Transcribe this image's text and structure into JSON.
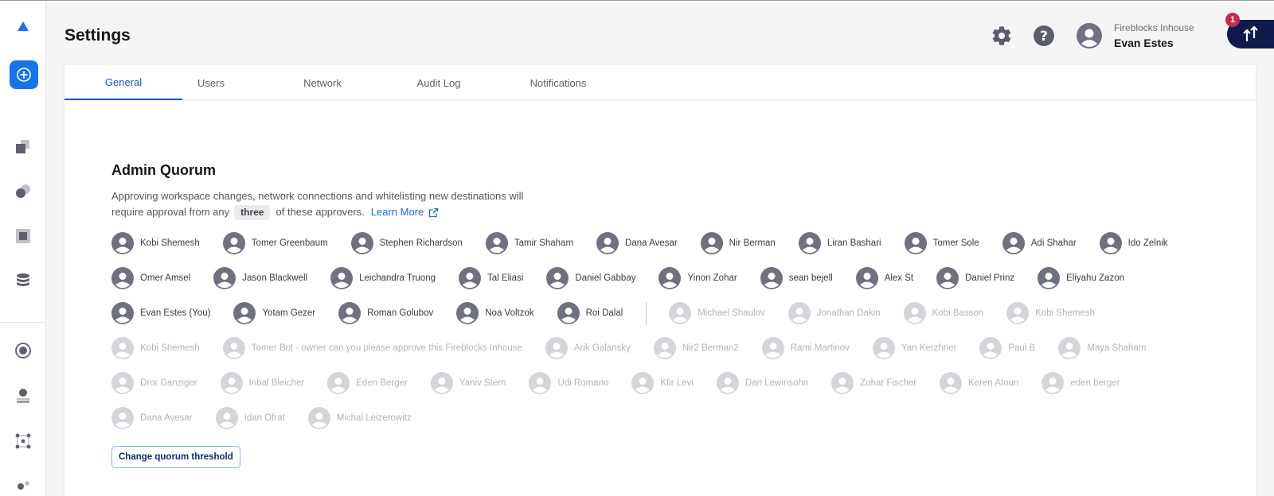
{
  "header": {
    "title": "Settings",
    "workspace": "Fireblocks Inhouse",
    "user": "Evan Estes",
    "notification_count": "1"
  },
  "icons": {
    "sidebar": [
      "logo-triangle-icon",
      "plus-icon",
      "squares-icon",
      "circles-icon",
      "square-icon",
      "database-icon",
      "radio-icon",
      "user-icon",
      "network-icon",
      "people-icon"
    ],
    "header": [
      "gear-icon",
      "help-icon",
      "avatar-icon",
      "transfer-arrows-icon"
    ]
  },
  "tabs": [
    {
      "label": "General",
      "active": true
    },
    {
      "label": "Users",
      "active": false
    },
    {
      "label": "Network",
      "active": false
    },
    {
      "label": "Audit Log",
      "active": false
    },
    {
      "label": "Notifications",
      "active": false
    }
  ],
  "quorum": {
    "title": "Admin Quorum",
    "desc_line1": "Approving workspace changes, network connections and whitelisting new destinations will",
    "desc_pre": "require approval from any",
    "threshold": "three",
    "desc_post": "of these approvers.",
    "learn_more": "Learn More",
    "change_button": "Change quorum threshold"
  },
  "approvers_active": [
    "Kobi Shemesh",
    "Tomer Greenbaum",
    "Stephen Richardson",
    "Tamir Shaham",
    "Dana Avesar",
    "Nir Berman",
    "Liran Bashari",
    "Tomer Sole",
    "Adi Shahar",
    "Ido Zelnik",
    "Omer Amsel",
    "Jason Blackwell",
    "Leichandra Truong",
    "Tal Eliasi",
    "Daniel Gabbay",
    "Yinon Zohar",
    "sean bejell",
    "Alex St",
    "Daniel Prinz",
    "Eliyahu Zazon",
    "Evan Estes (You)",
    "Yotam Gezer",
    "Roman Golubov",
    "Noa Voltzok",
    "Roi Dalal"
  ],
  "approvers_inactive": [
    "Michael Shaulov",
    "Jonathan Dakin",
    "Kobi Basson",
    "Kobi Shemesh",
    "Kobi Shemesh",
    "Tomer Bot - owner can you please approve this Fireblocks Inhouse",
    "Arik Galansky",
    "Nir2 Berman2",
    "Rami Martinov",
    "Yan Kerzhner",
    "Paul B",
    "Maya Shaham",
    "Dror Danziger",
    "Inbal Bleicher",
    "Eden Berger",
    "Yaniv Stern",
    "Udi Romano",
    "Kfir Levi",
    "Dan Lewinsohn",
    "Zohar Fischer",
    "Keren Atoun",
    "eden berger",
    "Dana Avesar",
    "Idan Ofrat",
    "Michal Leizerowitz"
  ],
  "colors": {
    "accent": "#1a55b8",
    "primary_button": "#1a73e8",
    "navy": "#0f1b4c",
    "badge": "#c62a4f",
    "avatar_active": "#6f7080",
    "avatar_inactive": "#d4d4da"
  }
}
